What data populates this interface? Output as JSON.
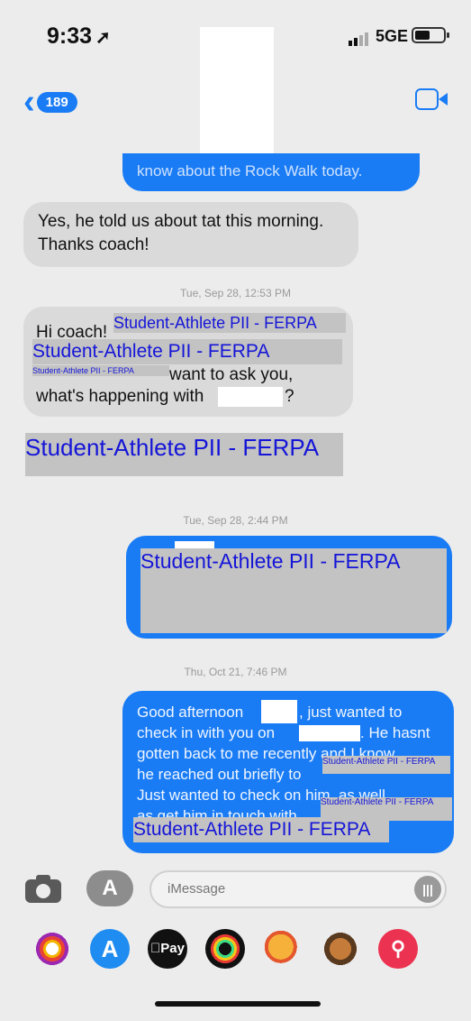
{
  "status_bar": {
    "time": "9:33",
    "network": "5GE"
  },
  "header": {
    "back_count": "189"
  },
  "messages": {
    "out_partial": "know about the Rock Walk today.",
    "in_reply_line1": "Yes, he told us about tat this morning.",
    "in_reply_line2": "Thanks coach!",
    "stamp1": "Tue, Sep 28, 12:53 PM",
    "in_hi": "Hi coach!",
    "in_want": "want to ask you,",
    "in_whats": "what's happening with",
    "in_q": "?",
    "stamp2": "Tue, Sep 28, 2:44 PM",
    "stamp3": "Thu, Oct 21, 7:46 PM",
    "out_good": "Good afternoon",
    "out_just": ", just wanted to",
    "out_check": "check in with you on",
    "out_hasnt": ". He hasnt",
    "out_gotten": "gotten back to me recently and I know",
    "out_he": "he reached out briefly to",
    "out_wanted": "Just wanted to check on him, as well",
    "out_get": "as get him in touch with"
  },
  "redaction_label": "Student-Athlete PII - FERPA",
  "compose": {
    "placeholder": "iMessage"
  },
  "app_tray": {
    "apple_pay": "Pay"
  },
  "colors": {
    "bubble_blue": "#1a7cf5",
    "bubble_grey": "#dadada",
    "redaction": "#c3c3c3",
    "redaction_text": "#1515d8"
  }
}
